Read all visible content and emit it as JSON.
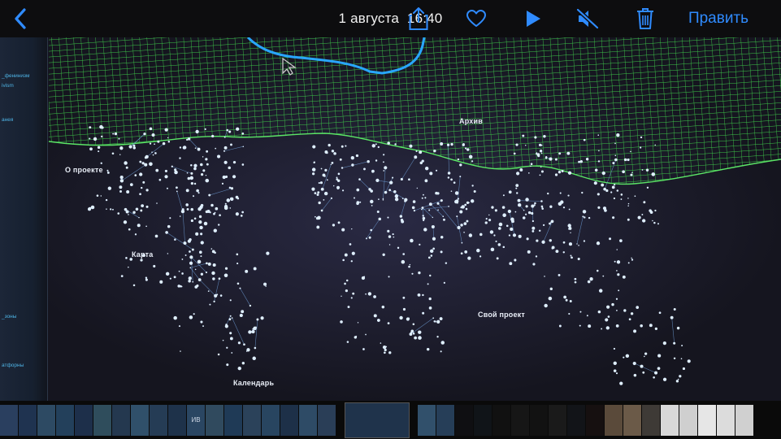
{
  "toolbar": {
    "date": "1 августа",
    "time": "16:40",
    "edit_label": "Править",
    "icons": [
      "back-chevron-icon",
      "share-icon",
      "heart-icon",
      "play-icon",
      "mute-icon",
      "trash-icon"
    ],
    "accent": "#2f8bff"
  },
  "map": {
    "labels": {
      "about": "О проекте",
      "archive": "Архив",
      "map": "Карта",
      "own_project": "Свой проект",
      "calendar": "Календарь"
    },
    "left_menu": [
      "_фенинизм",
      "ivism",
      "анея",
      "_зоны",
      "атфорны"
    ],
    "colors": {
      "background": "#1b1b2c",
      "grid": "#3fd04a",
      "dots": "#dfefff",
      "lines": "#6f9fd8",
      "route": "#29a6ff"
    }
  },
  "filmstrip": {
    "label": "ИВ",
    "thumb_colors": [
      "#2a3f5f",
      "#1f3350",
      "#2d4a63",
      "#23405b",
      "#1d2f4a",
      "#2f4d5c",
      "#24384f",
      "#30506a",
      "#253c55",
      "#1e324a",
      "#2a4662",
      "#304a5e",
      "#1f3a56",
      "#2b425a",
      "#284560",
      "#1d3048",
      "#2e4b66",
      "#2a3e57",
      "#1f334b",
      "#31506b",
      "#263e58"
    ]
  }
}
